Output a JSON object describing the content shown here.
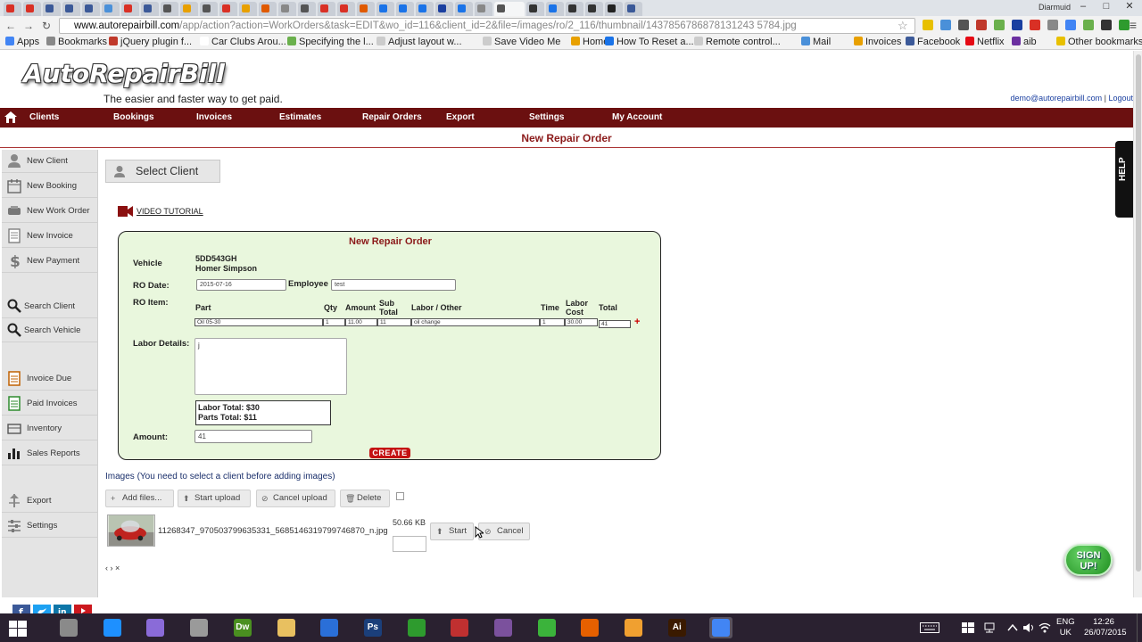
{
  "browser": {
    "user": "Diarmuid",
    "url_host": "www.autorepairbill.com",
    "url_path": "/app/action?action=WorkOrders&task=EDIT&wo_id=116&client_id=2&file=/images/ro/2_116/thumbnail/1437856786878131243 5784.jpg",
    "tabs": [
      {
        "favicon_color": "#d93025"
      },
      {
        "favicon_color": "#d93025"
      },
      {
        "favicon_color": "#3b5998"
      },
      {
        "favicon_color": "#3b5998"
      },
      {
        "favicon_color": "#3b5998"
      },
      {
        "favicon_color": "#4a90d9"
      },
      {
        "favicon_color": "#d93025"
      },
      {
        "favicon_color": "#3b5998"
      },
      {
        "favicon_color": "#555555"
      },
      {
        "favicon_color": "#e8a000"
      },
      {
        "favicon_color": "#555555"
      },
      {
        "favicon_color": "#d93025"
      },
      {
        "favicon_color": "#e8a000"
      },
      {
        "favicon_color": "#e05a00"
      },
      {
        "favicon_color": "#888888"
      },
      {
        "favicon_color": "#555555"
      },
      {
        "favicon_color": "#d93025"
      },
      {
        "favicon_color": "#d93025"
      },
      {
        "favicon_color": "#e05a00"
      },
      {
        "favicon_color": "#1a73e8"
      },
      {
        "favicon_color": "#1a73e8"
      },
      {
        "favicon_color": "#1a73e8"
      },
      {
        "favicon_color": "#1a3fa0"
      },
      {
        "favicon_color": "#1a73e8"
      },
      {
        "favicon_color": "#888888"
      },
      {
        "favicon_color": "#555555",
        "active": true
      },
      {
        "favicon_color": "#333333"
      },
      {
        "favicon_color": "#1a73e8"
      },
      {
        "favicon_color": "#333333"
      },
      {
        "favicon_color": "#333333"
      },
      {
        "favicon_color": "#222222"
      },
      {
        "favicon_color": "#3b5998"
      }
    ],
    "bookmarks": [
      {
        "label": "Apps",
        "color": "#4285f4"
      },
      {
        "label": "Bookmarks",
        "color": "#888888"
      },
      {
        "label": "jQuery plugin f...",
        "color": "#c0392b"
      },
      {
        "label": "Car Clubs Arou...",
        "color": "#ffffff"
      },
      {
        "label": "Specifying the l...",
        "color": "#6ab04c"
      },
      {
        "label": "Adjust layout w...",
        "color": "#cccccc"
      },
      {
        "label": "Save Video Me",
        "color": "#cccccc"
      },
      {
        "label": "Home",
        "color": "#e8a000"
      },
      {
        "label": "How To Reset a...",
        "color": "#1a73e8"
      },
      {
        "label": "Remote control...",
        "color": "#cccccc"
      },
      {
        "label": "Mail",
        "color": "#4a90d9"
      },
      {
        "label": "Invoices",
        "color": "#e8a000"
      },
      {
        "label": "Facebook",
        "color": "#3b5998"
      },
      {
        "label": "Netflix",
        "color": "#e50914"
      },
      {
        "label": "aib",
        "color": "#6b2fa0"
      },
      {
        "label": "Other bookmarks",
        "color": "#e8c000"
      }
    ]
  },
  "site": {
    "logo": "AutoRepairBill",
    "tagline": "The easier and faster way to get paid.",
    "account_email": "demo@autorepairbill.com",
    "separator": " | ",
    "logout": "Logout",
    "nav": [
      "Clients",
      "Bookings",
      "Invoices",
      "Estimates",
      "Repair Orders",
      "Export",
      "Settings",
      "My Account"
    ],
    "page_title": "New Repair Order",
    "help": "HELP",
    "signup_line1": "SIGN",
    "signup_line2": "UP!"
  },
  "sidebar": [
    {
      "label": "New Client",
      "icon": "person-icon"
    },
    {
      "label": "New Booking",
      "icon": "calendar-icon"
    },
    {
      "label": "New Work Order",
      "icon": "wrench-icon"
    },
    {
      "label": "New Invoice",
      "icon": "document-icon"
    },
    {
      "label": "New Payment",
      "icon": "dollar-icon"
    },
    {
      "label": "Search Client",
      "icon": "magnifier-icon"
    },
    {
      "label": "Search Vehicle",
      "icon": "magnifier-icon"
    },
    {
      "label": "Invoice Due",
      "icon": "invoice-icon"
    },
    {
      "label": "Paid Invoices",
      "icon": "paid-invoice-icon"
    },
    {
      "label": "Inventory",
      "icon": "box-icon"
    },
    {
      "label": "Sales Reports",
      "icon": "bar-chart-icon"
    },
    {
      "label": "Export",
      "icon": "export-icon"
    },
    {
      "label": "Settings",
      "icon": "sliders-icon"
    }
  ],
  "main": {
    "select_client": "Select Client",
    "video_tutorial": "VIDEO TUTORIAL",
    "form": {
      "title": "New Repair Order",
      "vehicle_label": "Vehicle",
      "vehicle_reg": "5DD543GH",
      "vehicle_owner": "Homer Simpson",
      "ro_date_label": "RO Date:",
      "ro_date": "2015-07-16",
      "employee_label": "Employee",
      "employee": "test",
      "ro_item_label": "RO Item:",
      "columns": {
        "part": "Part",
        "qty": "Qty",
        "amount": "Amount",
        "subtotal_1": "Sub",
        "subtotal_2": "Total",
        "labor": "Labor / Other",
        "time": "Time",
        "labor_cost_1": "Labor",
        "labor_cost_2": "Cost",
        "total": "Total"
      },
      "item": {
        "part": "Oil 05-30",
        "qty": "1",
        "amount": "11.00",
        "subtotal": "11",
        "labor": "oil change",
        "time": "1",
        "labor_cost": "30.00",
        "total": "41"
      },
      "add_line": "+",
      "labor_details_label": "Labor Details:",
      "labor_details": "j",
      "labor_total": "Labor Total: $30",
      "parts_total": "Parts Total: $11",
      "amount_label": "Amount:",
      "amount": "41",
      "create": "CREATE"
    },
    "images_label": "Images (You need to select a client before adding images)",
    "upload_buttons": [
      "Add files...",
      "Start upload",
      "Cancel upload",
      "Delete"
    ],
    "file": {
      "name": "11268347_970503799635331_5685146319799746870_n.jpg",
      "size": "50.66 KB",
      "start": "Start",
      "cancel": "Cancel"
    },
    "pager": "‹ › ×"
  },
  "taskbar": {
    "lang_1": "ENG",
    "lang_2": "UK",
    "time": "12:26",
    "date": "26/07/2015",
    "apps": [
      {
        "name": "laptop",
        "color": "#8a8a8a"
      },
      {
        "name": "ie",
        "color": "#1e90ff"
      },
      {
        "name": "orb",
        "color": "#8a6bd8"
      },
      {
        "name": "files",
        "color": "#9a9a9a"
      },
      {
        "name": "dreamweaver",
        "color": "#4a8f20",
        "label": "Dw"
      },
      {
        "name": "folder",
        "color": "#e8c060"
      },
      {
        "name": "network",
        "color": "#2a6fd8"
      },
      {
        "name": "photoshop",
        "color": "#1b3f7a",
        "label": "Ps"
      },
      {
        "name": "store",
        "color": "#2e9b2e"
      },
      {
        "name": "apps",
        "color": "#c03030"
      },
      {
        "name": "viber",
        "color": "#7b519d"
      },
      {
        "name": "media",
        "color": "#3bb33b"
      },
      {
        "name": "firefox",
        "color": "#e66000"
      },
      {
        "name": "outlook",
        "color": "#f0a030"
      },
      {
        "name": "illustrator",
        "color": "#3a1a00",
        "label": "Ai"
      },
      {
        "name": "chrome",
        "color": "#4285f4",
        "active": true
      }
    ]
  }
}
